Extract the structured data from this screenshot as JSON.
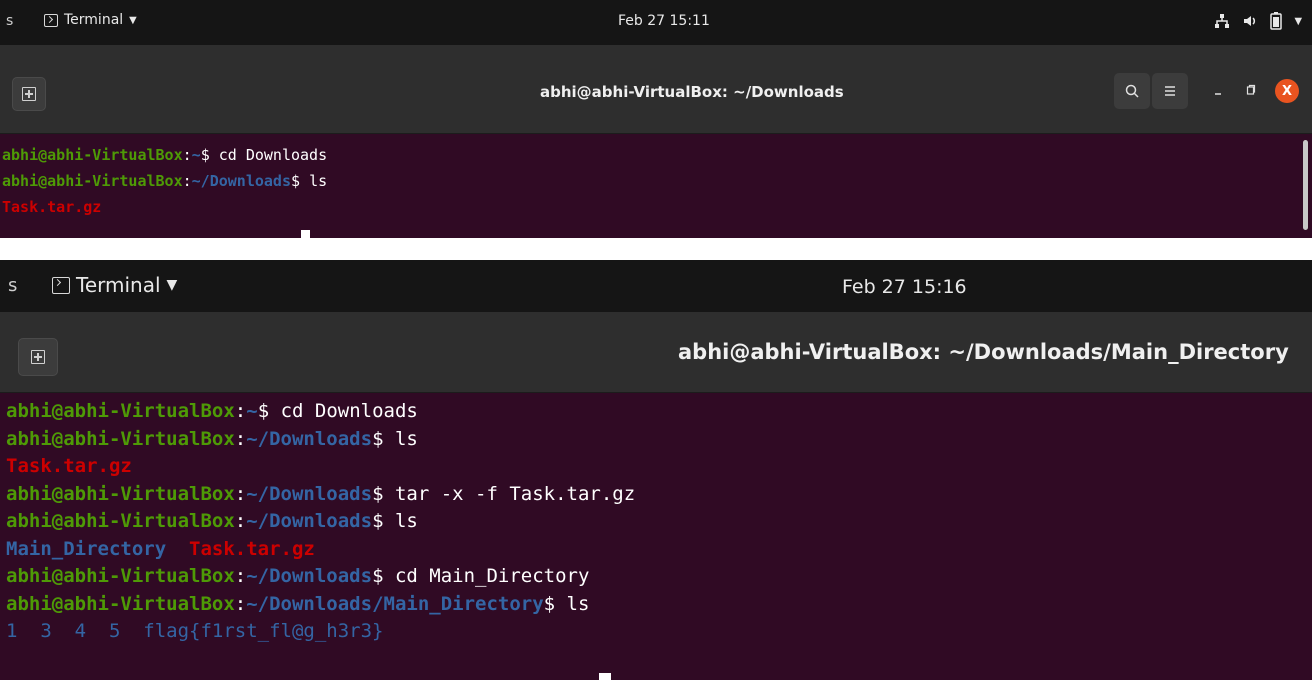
{
  "shot1": {
    "activities": "s",
    "app_menu": "Terminal",
    "clock": "Feb 27 15:11",
    "window_title": "abhi@abhi-VirtualBox: ~/Downloads",
    "close_label": "X",
    "lines": [
      {
        "user": "abhi@abhi-VirtualBox",
        "path": "~",
        "cmd": "cd Downloads"
      },
      {
        "user": "abhi@abhi-VirtualBox",
        "path": "~/Downloads",
        "cmd": "ls"
      }
    ],
    "ls_output_1": "Task.tar.gz"
  },
  "shot2": {
    "activities": "s",
    "app_menu": "Terminal",
    "clock": "Feb 27 15:16",
    "window_title": "abhi@abhi-VirtualBox: ~/Downloads/Main_Directory",
    "lines": [
      {
        "user": "abhi@abhi-VirtualBox",
        "path": "~",
        "cmd": "cd Downloads"
      },
      {
        "user": "abhi@abhi-VirtualBox",
        "path": "~/Downloads",
        "cmd": "ls"
      },
      {
        "user": "abhi@abhi-VirtualBox",
        "path": "~/Downloads",
        "cmd": "tar -x -f Task.tar.gz"
      },
      {
        "user": "abhi@abhi-VirtualBox",
        "path": "~/Downloads",
        "cmd": "ls"
      },
      {
        "user": "abhi@abhi-VirtualBox",
        "path": "~/Downloads",
        "cmd": "cd Main_Directory"
      },
      {
        "user": "abhi@abhi-VirtualBox",
        "path": "~/Downloads/Main_Directory",
        "cmd": "ls"
      }
    ],
    "ls_output_1": "Task.tar.gz",
    "ls_output_2": {
      "dir": "Main_Directory",
      "file": "Task.tar.gz"
    },
    "ls_output_3": "1  3  4  5  flag{f1rst_fl@g_h3r3}"
  },
  "colors": {
    "terminal_bg": "#300a24",
    "user_green": "#4e9a06",
    "path_blue": "#3465a4",
    "archive_red": "#cc0000",
    "close_orange": "#e95420"
  }
}
